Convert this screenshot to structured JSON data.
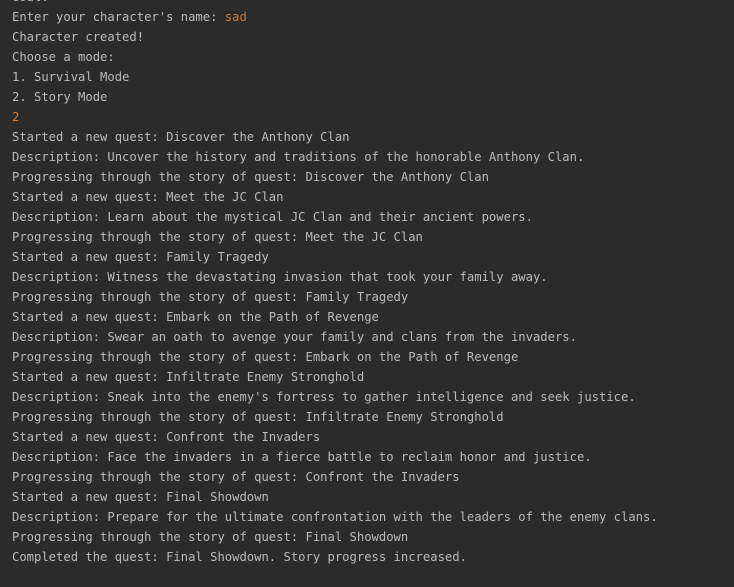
{
  "colors": {
    "background": "#2b2b2b",
    "output_text": "#bbbbbb",
    "user_input": "#cc7832"
  },
  "console": {
    "lines": [
      {
        "text": "Goal:"
      },
      {
        "text": "Enter your character's name: ",
        "input": "sad"
      },
      {
        "text": "Character created!"
      },
      {
        "text": "Choose a mode:"
      },
      {
        "text": "1. Survival Mode"
      },
      {
        "text": "2. Story Mode"
      },
      {
        "text": "",
        "input": "2"
      },
      {
        "text": "Started a new quest: Discover the Anthony Clan"
      },
      {
        "text": "Description: Uncover the history and traditions of the honorable Anthony Clan."
      },
      {
        "text": "Progressing through the story of quest: Discover the Anthony Clan"
      },
      {
        "text": "Started a new quest: Meet the JC Clan"
      },
      {
        "text": "Description: Learn about the mystical JC Clan and their ancient powers."
      },
      {
        "text": "Progressing through the story of quest: Meet the JC Clan"
      },
      {
        "text": "Started a new quest: Family Tragedy"
      },
      {
        "text": "Description: Witness the devastating invasion that took your family away."
      },
      {
        "text": "Progressing through the story of quest: Family Tragedy"
      },
      {
        "text": "Started a new quest: Embark on the Path of Revenge"
      },
      {
        "text": "Description: Swear an oath to avenge your family and clans from the invaders."
      },
      {
        "text": "Progressing through the story of quest: Embark on the Path of Revenge"
      },
      {
        "text": "Started a new quest: Infiltrate Enemy Stronghold"
      },
      {
        "text": "Description: Sneak into the enemy's fortress to gather intelligence and seek justice."
      },
      {
        "text": "Progressing through the story of quest: Infiltrate Enemy Stronghold"
      },
      {
        "text": "Started a new quest: Confront the Invaders"
      },
      {
        "text": "Description: Face the invaders in a fierce battle to reclaim honor and justice."
      },
      {
        "text": "Progressing through the story of quest: Confront the Invaders"
      },
      {
        "text": "Started a new quest: Final Showdown"
      },
      {
        "text": "Description: Prepare for the ultimate confrontation with the leaders of the enemy clans."
      },
      {
        "text": "Progressing through the story of quest: Final Showdown"
      },
      {
        "text": "Completed the quest: Final Showdown. Story progress increased."
      }
    ]
  }
}
